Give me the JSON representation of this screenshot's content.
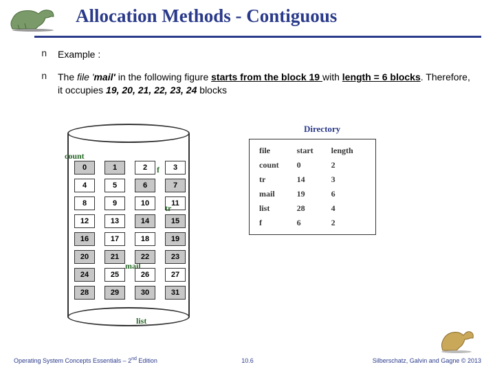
{
  "title": "Allocation Methods - Contiguous",
  "bullets": {
    "b1": "Example :",
    "b2a": "The ",
    "b2b": "file '",
    "b2c": "mail'",
    "b2d": " in the following figure ",
    "b2e": "starts from the block 19 ",
    "b2f": "with ",
    "b2g": "length = 6 blocks",
    "b2h": ". Therefore, it occupies ",
    "b2i": "19, 20, 21, 22, 23, 24",
    "b2j": " blocks"
  },
  "disk": {
    "count": "count",
    "f": "f",
    "tr": "tr",
    "mail": "mail",
    "list": "list",
    "blocks": [
      "0",
      "1",
      "2",
      "3",
      "4",
      "5",
      "6",
      "7",
      "8",
      "9",
      "10",
      "11",
      "12",
      "13",
      "14",
      "15",
      "16",
      "17",
      "18",
      "19",
      "20",
      "21",
      "22",
      "23",
      "24",
      "25",
      "26",
      "27",
      "28",
      "29",
      "30",
      "31"
    ]
  },
  "directory": {
    "title": "Directory",
    "h1": "file",
    "h2": "start",
    "h3": "length",
    "rows": [
      {
        "f": "count",
        "s": "0",
        "l": "2"
      },
      {
        "f": "tr",
        "s": "14",
        "l": "3"
      },
      {
        "f": "mail",
        "s": "19",
        "l": "6"
      },
      {
        "f": "list",
        "s": "28",
        "l": "4"
      },
      {
        "f": "f",
        "s": "6",
        "l": "2"
      }
    ]
  },
  "footer": {
    "left": "Operating System Concepts Essentials – 2",
    "left2": " Edition",
    "sup": "nd",
    "center": "10.6",
    "right": "Silberschatz, Galvin and Gagne © 2013"
  }
}
